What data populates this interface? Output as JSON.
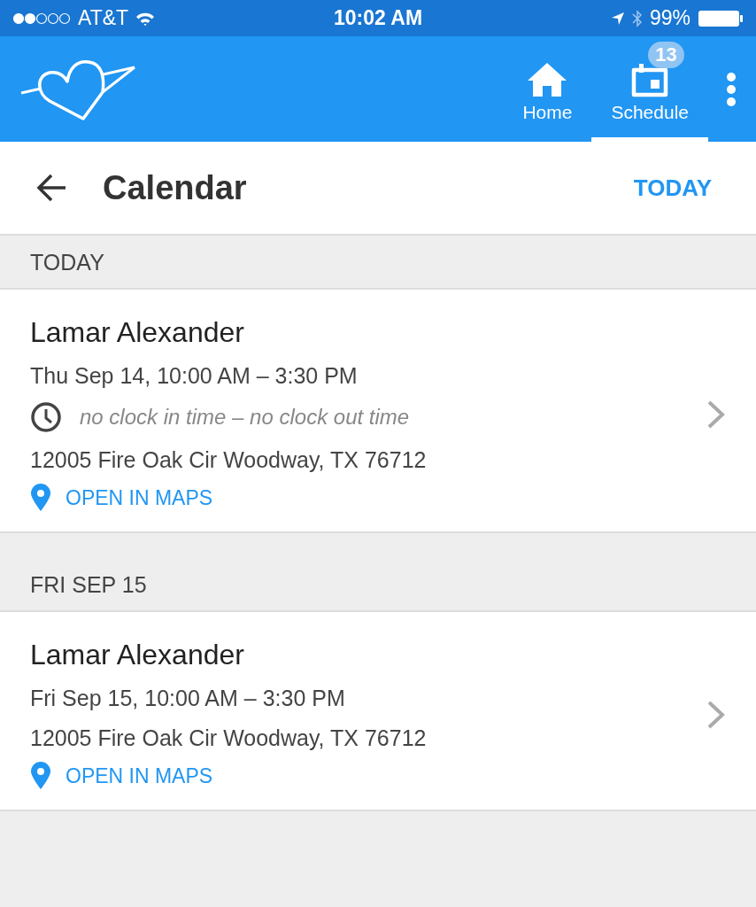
{
  "status_bar": {
    "carrier": "AT&T",
    "time": "10:02 AM",
    "battery": "99%"
  },
  "app_bar": {
    "nav": [
      {
        "label": "Home",
        "kind": "home",
        "selected": false
      },
      {
        "label": "Schedule",
        "kind": "schedule",
        "selected": true,
        "badge": "13"
      }
    ]
  },
  "header": {
    "title": "Calendar",
    "action": "TODAY"
  },
  "sections": [
    {
      "heading": "TODAY",
      "events": [
        {
          "name": "Lamar Alexander",
          "when": "Thu Sep 14, 10:00 AM – 3:30 PM",
          "clock": "*no clock in time* – *no clock out time*",
          "address": "12005 Fire Oak Cir Woodway, TX 76712",
          "maps": "OPEN IN MAPS"
        }
      ]
    },
    {
      "heading": "FRI SEP 15",
      "events": [
        {
          "name": "Lamar Alexander",
          "when": "Fri Sep 15, 10:00 AM – 3:30 PM",
          "address": "12005 Fire Oak Cir Woodway, TX 76712",
          "maps": "OPEN IN MAPS"
        }
      ]
    }
  ]
}
